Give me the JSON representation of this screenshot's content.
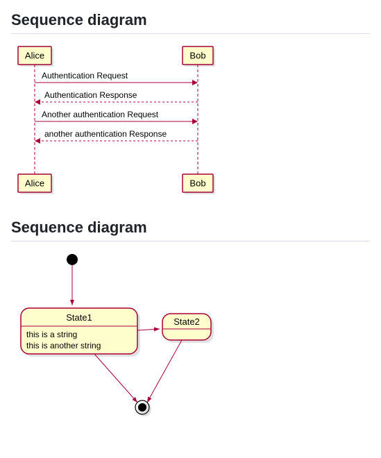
{
  "diagrams": [
    {
      "title": "Sequence diagram",
      "type": "sequence",
      "participants": [
        "Alice",
        "Bob"
      ],
      "messages": [
        {
          "from": "Alice",
          "to": "Bob",
          "label": "Authentication Request",
          "style": "solid"
        },
        {
          "from": "Bob",
          "to": "Alice",
          "label": "Authentication Response",
          "style": "dashed"
        },
        {
          "from": "Alice",
          "to": "Bob",
          "label": "Another authentication Request",
          "style": "solid"
        },
        {
          "from": "Bob",
          "to": "Alice",
          "label": "another authentication Response",
          "style": "dashed"
        }
      ]
    },
    {
      "title": "Sequence diagram",
      "type": "state",
      "initial": true,
      "final": true,
      "states": [
        {
          "name": "State1",
          "body": [
            "this is a string",
            "this is another string"
          ]
        },
        {
          "name": "State2",
          "body": []
        }
      ],
      "transitions": [
        {
          "from": "__initial__",
          "to": "State1"
        },
        {
          "from": "State1",
          "to": "State2"
        },
        {
          "from": "State1",
          "to": "__final__"
        },
        {
          "from": "State2",
          "to": "__final__"
        }
      ]
    }
  ]
}
